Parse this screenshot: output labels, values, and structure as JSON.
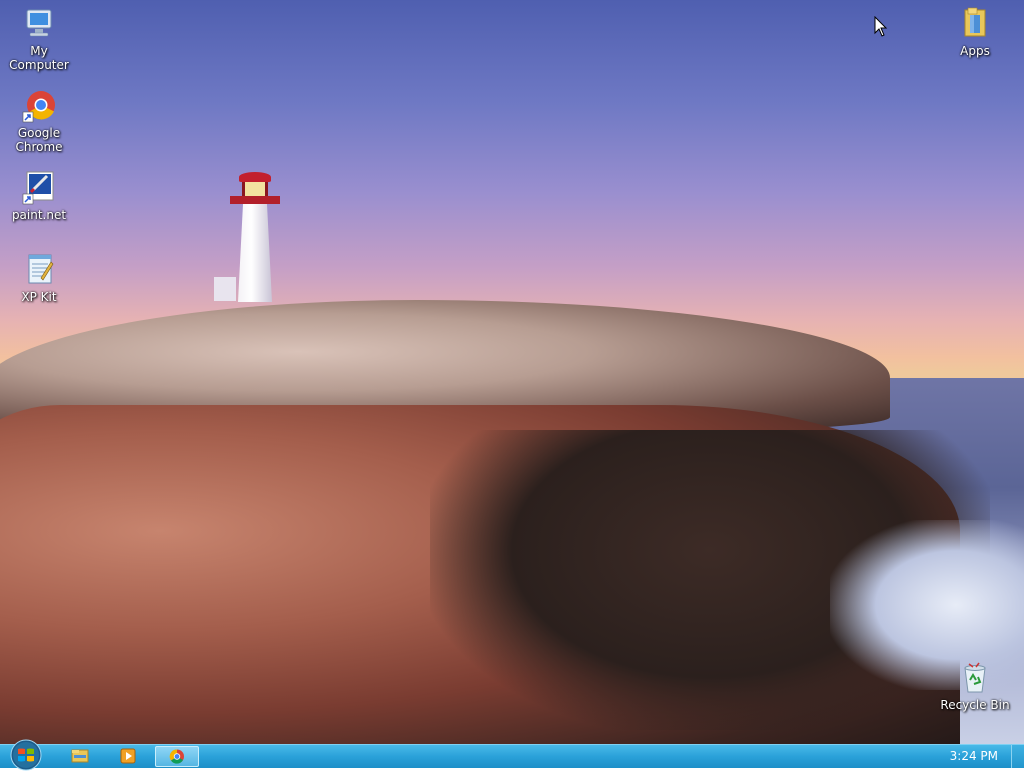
{
  "desktop": {
    "icons": {
      "my_computer": {
        "label": "My Computer",
        "icon": "computer-icon"
      },
      "google_chrome": {
        "label": "Google Chrome",
        "icon": "chrome-icon"
      },
      "paint_net": {
        "label": "paint.net",
        "icon": "paint-net-icon"
      },
      "xp_kit": {
        "label": "XP Kit",
        "icon": "notepad-icon"
      },
      "apps": {
        "label": "Apps",
        "icon": "folder-icon"
      },
      "recycle_bin": {
        "label": "Recycle Bin",
        "icon": "recycle-bin-icon"
      }
    }
  },
  "taskbar": {
    "start_icon": "windows-logo-icon",
    "buttons": [
      {
        "icon": "file-explorer-icon"
      },
      {
        "icon": "media-player-icon"
      },
      {
        "icon": "chrome-icon",
        "active": true
      }
    ],
    "clock": "3:24 PM"
  },
  "colors": {
    "taskbar": "#2aa1d9",
    "label_text": "#ffffff"
  }
}
